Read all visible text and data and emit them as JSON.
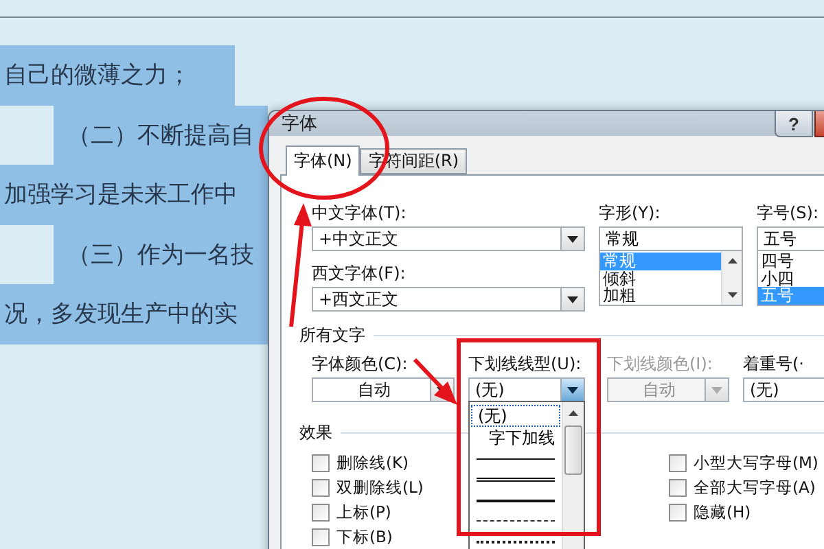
{
  "document": {
    "lines": [
      {
        "kind": "plain",
        "text": "自己的微薄之力；"
      },
      {
        "kind": "indented",
        "text": "（二）不断提高自"
      },
      {
        "kind": "plain",
        "text": "加强学习是未来工作中"
      },
      {
        "kind": "indented",
        "text": "（三）作为一名技"
      },
      {
        "kind": "plain",
        "text": "况，多发现生产中的实"
      }
    ]
  },
  "dialog": {
    "title": "字体",
    "help_button": "?",
    "tabs": [
      {
        "label": "字体(N)",
        "selected": true
      },
      {
        "label": "字符间距(R)",
        "selected": false
      }
    ],
    "chinese_font": {
      "label": "中文字体(T):",
      "value": "+中文正文"
    },
    "western_font": {
      "label": "西文字体(F):",
      "value": "+西文正文"
    },
    "font_style": {
      "label": "字形(Y):",
      "value": "常规",
      "options": [
        {
          "label": "常规",
          "selected": true
        },
        {
          "label": "倾斜",
          "selected": false
        },
        {
          "label": "加粗",
          "selected": false
        }
      ]
    },
    "font_size": {
      "label": "字号(S):",
      "value": "五号",
      "options": [
        {
          "label": "四号",
          "selected": false
        },
        {
          "label": "小四",
          "selected": false
        },
        {
          "label": "五号",
          "selected": true
        }
      ]
    },
    "all_text": {
      "title": "所有文字",
      "fields": [
        {
          "label": "字体颜色(C):",
          "value": "自动",
          "disabled": false,
          "expanded": false
        },
        {
          "label": "下划线线型(U):",
          "value": "(无)",
          "disabled": false,
          "expanded": true
        },
        {
          "label": "下划线颜色(I):",
          "value": "自动",
          "disabled": true,
          "expanded": false
        },
        {
          "label": "着重号(·",
          "value": "(无)",
          "disabled": false,
          "expanded": false
        }
      ]
    },
    "underline_options": [
      {
        "kind": "text",
        "label": "(无)",
        "selected": true
      },
      {
        "kind": "text",
        "label": "字下加线",
        "selected": false
      },
      {
        "kind": "line",
        "selected": false
      },
      {
        "kind": "line",
        "selected": false
      },
      {
        "kind": "line",
        "selected": false
      },
      {
        "kind": "line",
        "selected": false
      },
      {
        "kind": "line",
        "selected": false
      }
    ],
    "effects": {
      "title": "效果",
      "left": [
        {
          "label": "删除线(K)",
          "checked": false
        },
        {
          "label": "双删除线(L)",
          "checked": false
        },
        {
          "label": "上标(P)",
          "checked": false
        },
        {
          "label": "下标(B)",
          "checked": false
        }
      ],
      "right": [
        {
          "label": "小型大写字母(M)",
          "checked": false
        },
        {
          "label": "全部大写字母(A)",
          "checked": false
        },
        {
          "label": "隐藏(H)",
          "checked": false
        }
      ]
    }
  }
}
